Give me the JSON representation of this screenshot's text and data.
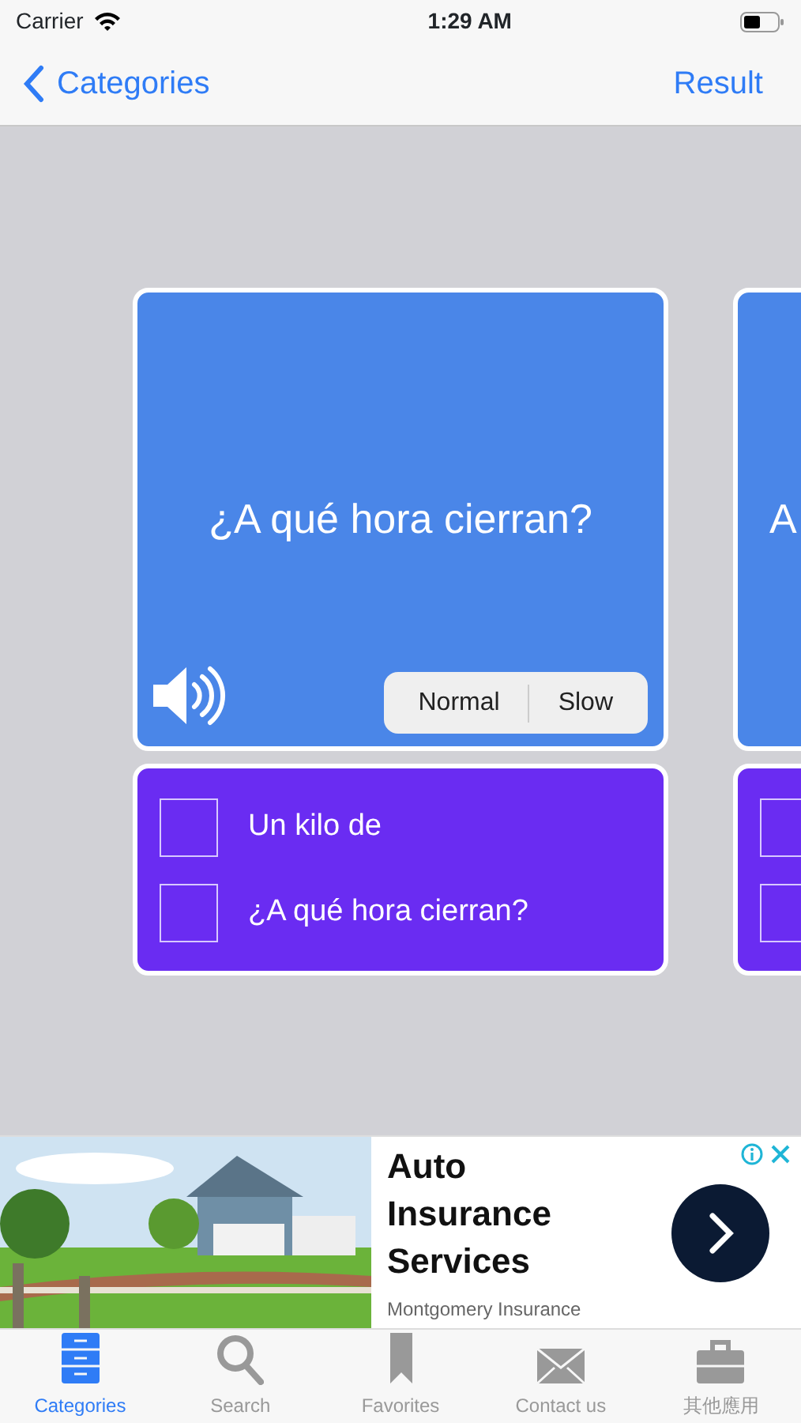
{
  "status_bar": {
    "carrier": "Carrier",
    "time": "1:29 AM"
  },
  "nav": {
    "back": "Categories",
    "action": "Result"
  },
  "cards": [
    {
      "question": "¿A qué hora cierran?",
      "speeds": [
        {
          "label": "Normal",
          "selected": false
        },
        {
          "label": "Slow",
          "selected": false
        }
      ],
      "options": [
        {
          "label": "Un kilo de",
          "checked": false
        },
        {
          "label": "¿A qué hora cierran?",
          "checked": false
        }
      ]
    },
    {
      "question": "A",
      "options": [
        {
          "checked": false
        },
        {
          "checked": false
        }
      ]
    }
  ],
  "ad": {
    "kind": "picture",
    "headline_lines": [
      "Auto",
      "Insurance",
      "Services"
    ],
    "advertiser": "Montgomery Insurance"
  },
  "tabs": [
    {
      "label": "Categories",
      "selected": true
    },
    {
      "label": "Search",
      "selected": false
    },
    {
      "label": "Favorites",
      "selected": false
    },
    {
      "label": "Contact us",
      "selected": false
    },
    {
      "label": "其他應用",
      "selected": false
    }
  ]
}
